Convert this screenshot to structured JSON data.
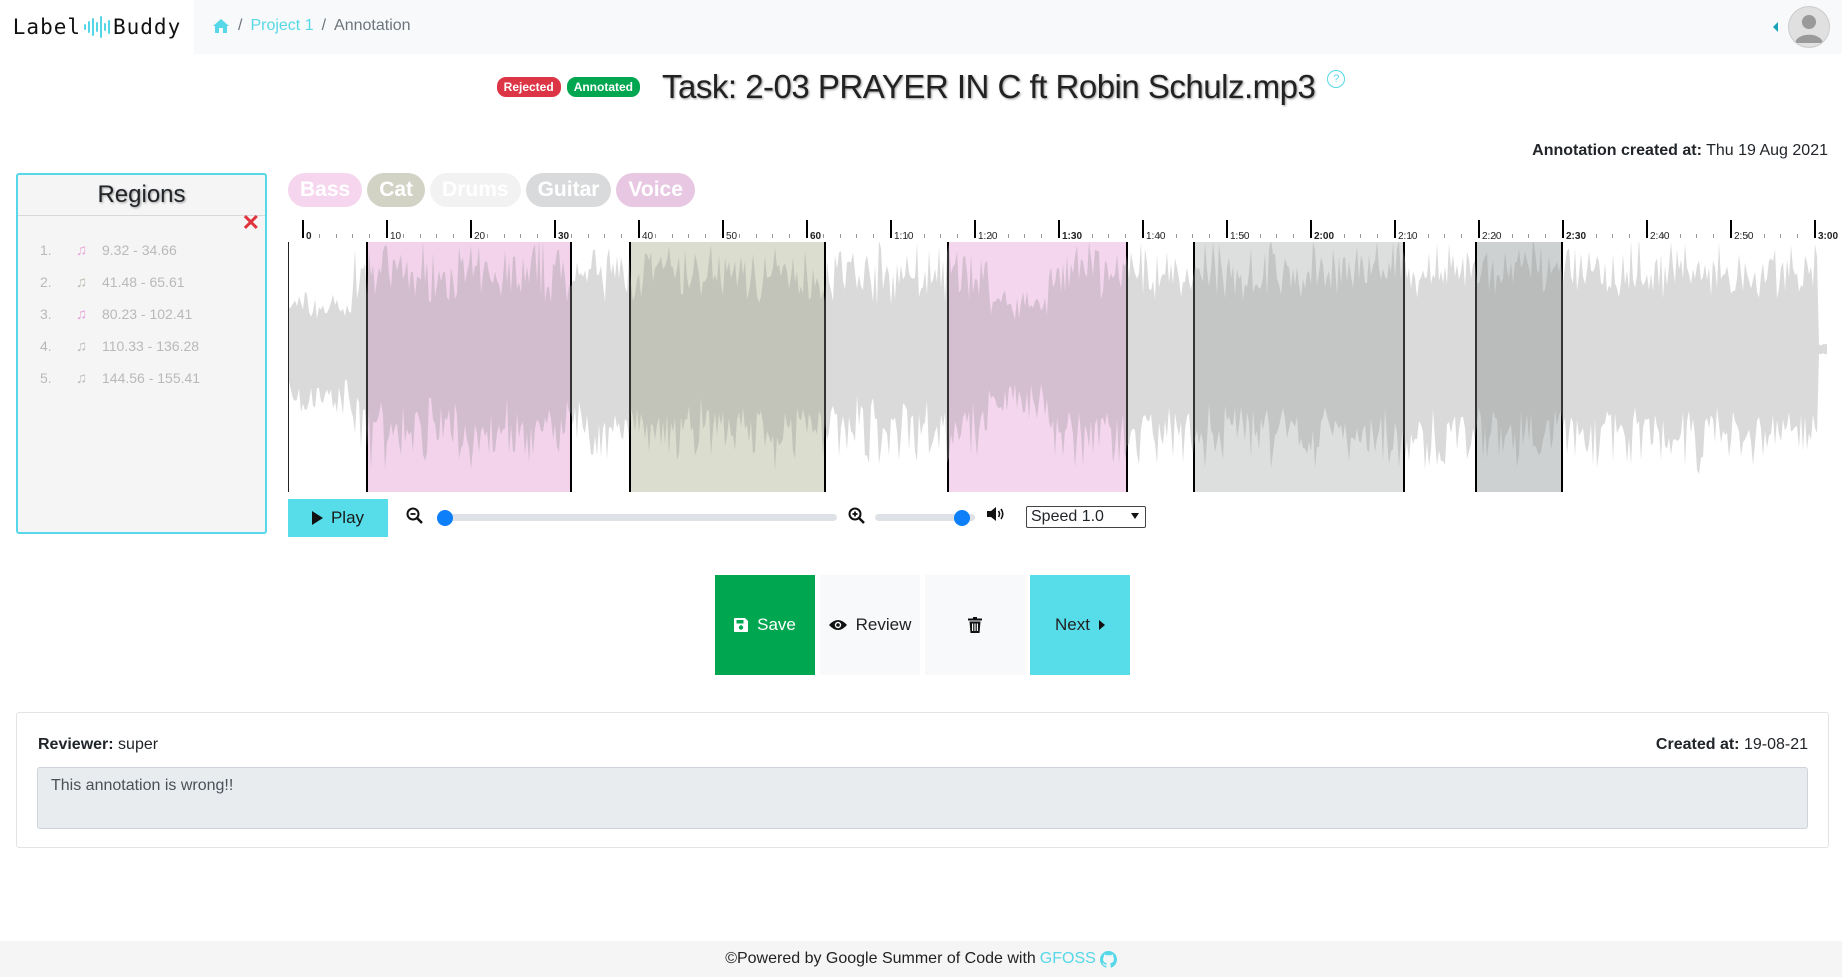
{
  "app": {
    "brand_left": "Label",
    "brand_right": "Buddy"
  },
  "breadcrumb": {
    "items": [
      "Project 1",
      "Annotation"
    ],
    "separator": "/"
  },
  "task": {
    "status_badges": [
      {
        "label": "Rejected",
        "color": "#dc3545"
      },
      {
        "label": "Annotated",
        "color": "#00a650"
      }
    ],
    "title": "Task: 2-03 PRAYER IN C ft Robin Schulz.mp3",
    "help_glyph": "?"
  },
  "annotation_meta": {
    "created_label": "Annotation created at:",
    "created_value": "Thu 19 Aug 2021"
  },
  "regions_panel": {
    "title": "Regions",
    "close_glyph": "✕",
    "items": [
      {
        "num": "1.",
        "range": "9.32 - 34.66"
      },
      {
        "num": "2.",
        "range": "41.48 - 65.61"
      },
      {
        "num": "3.",
        "range": "80.23 - 102.41"
      },
      {
        "num": "4.",
        "range": "110.33 - 136.28"
      },
      {
        "num": "5.",
        "range": "144.56 - 155.41"
      }
    ]
  },
  "labels": [
    {
      "name": "Bass",
      "color": "#f6d6ee"
    },
    {
      "name": "Cat",
      "color": "#d2d3c4"
    },
    {
      "name": "Drums",
      "color": "#f2f2f2"
    },
    {
      "name": "Guitar",
      "color": "#d9dadb"
    },
    {
      "name": "Voice",
      "color": "#e8c7e2"
    }
  ],
  "timeline": {
    "duration_s": 186,
    "labels": [
      "0",
      "10",
      "20",
      "30",
      "40",
      "50",
      "60",
      "1:10",
      "1:20",
      "1:30",
      "1:40",
      "1:50",
      "2:00",
      "2:10",
      "2:20",
      "2:30",
      "2:40",
      "2:50",
      "3:00"
    ]
  },
  "player": {
    "play_label": "Play",
    "speed_label": "Speed 1.0",
    "zoom_level": 0.0,
    "volume_level": 1.0
  },
  "actions": {
    "save": "Save",
    "review": "Review",
    "next": "Next"
  },
  "review": {
    "reviewer_label": "Reviewer:",
    "reviewer_value": "super",
    "created_label": "Created at:",
    "created_value": "19-08-21",
    "comment": "This annotation is wrong!!"
  },
  "footer": {
    "text": "©Powered by Google Summer of Code with",
    "link": "GFOSS"
  }
}
